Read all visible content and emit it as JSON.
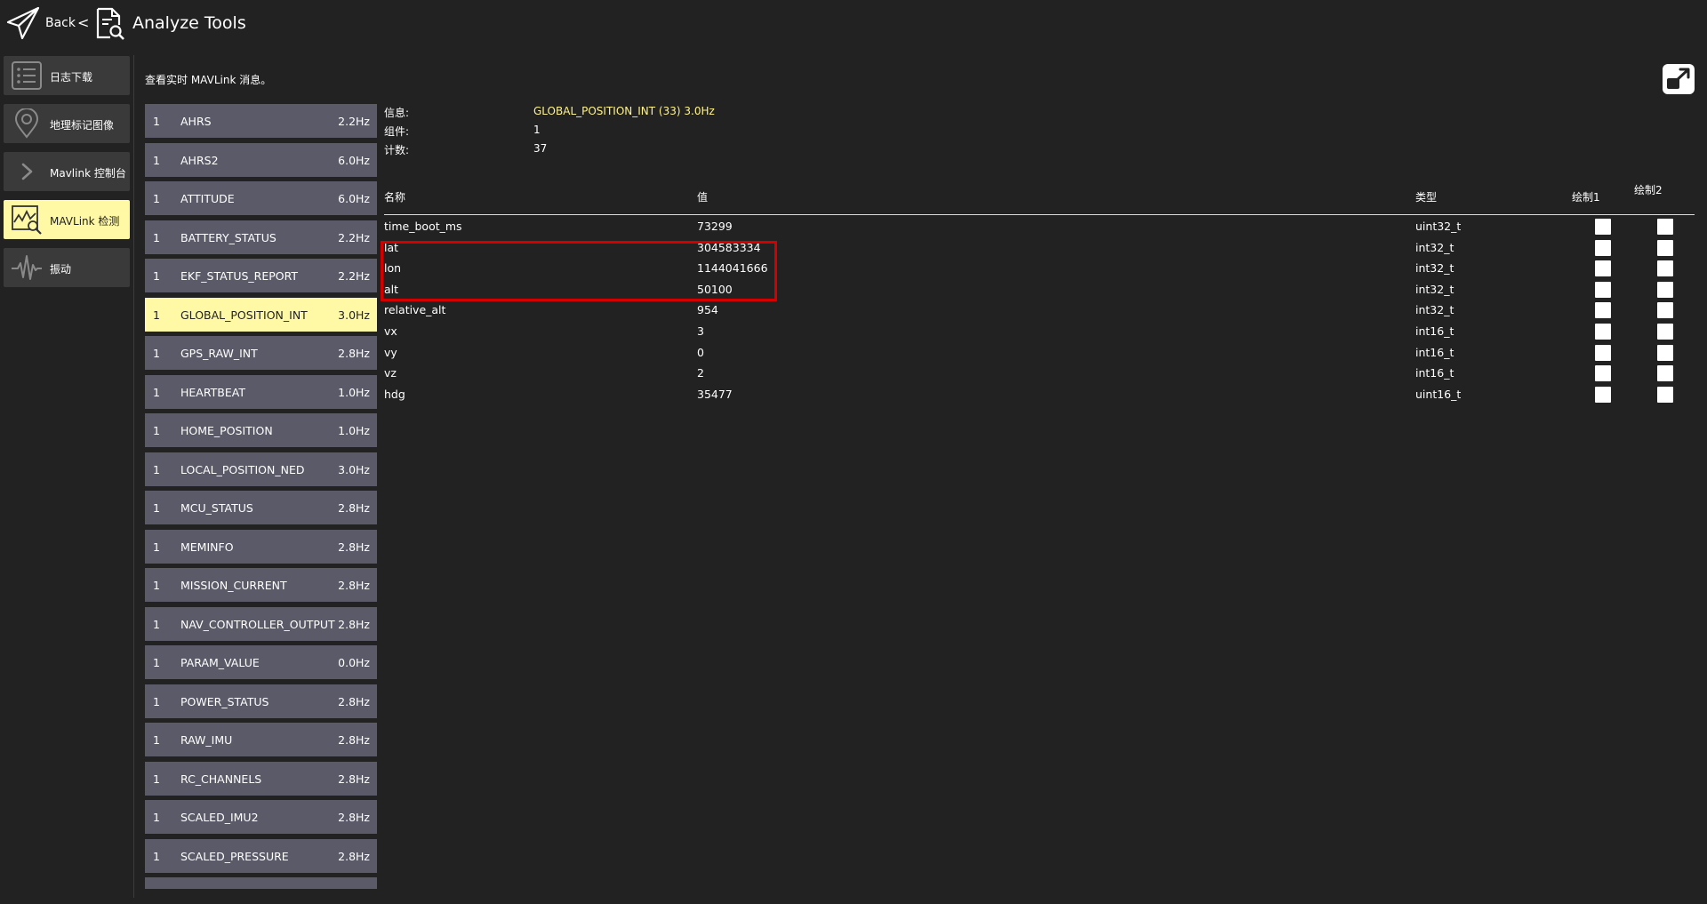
{
  "header": {
    "back_label": "Back",
    "separator": "<",
    "title": "Analyze Tools"
  },
  "nav": [
    {
      "label": "日志下载",
      "icon": "list-icon",
      "active": false
    },
    {
      "label": "地理标记图像",
      "icon": "map-pin-icon",
      "active": false
    },
    {
      "label": "Mavlink 控制台",
      "icon": "chevron-right-icon",
      "active": false
    },
    {
      "label": "MAVLink 检测",
      "icon": "chart-magnifier-icon",
      "active": true
    },
    {
      "label": "振动",
      "icon": "waveform-icon",
      "active": false
    }
  ],
  "description": "查看实时 MAVLink 消息。",
  "messages": [
    {
      "comp": "1",
      "name": "AHRS",
      "rate": "2.2Hz"
    },
    {
      "comp": "1",
      "name": "AHRS2",
      "rate": "6.0Hz"
    },
    {
      "comp": "1",
      "name": "ATTITUDE",
      "rate": "6.0Hz"
    },
    {
      "comp": "1",
      "name": "BATTERY_STATUS",
      "rate": "2.2Hz"
    },
    {
      "comp": "1",
      "name": "EKF_STATUS_REPORT",
      "rate": "2.2Hz"
    },
    {
      "comp": "1",
      "name": "GLOBAL_POSITION_INT",
      "rate": "3.0Hz",
      "selected": true
    },
    {
      "comp": "1",
      "name": "GPS_RAW_INT",
      "rate": "2.8Hz"
    },
    {
      "comp": "1",
      "name": "HEARTBEAT",
      "rate": "1.0Hz"
    },
    {
      "comp": "1",
      "name": "HOME_POSITION",
      "rate": "1.0Hz"
    },
    {
      "comp": "1",
      "name": "LOCAL_POSITION_NED",
      "rate": "3.0Hz"
    },
    {
      "comp": "1",
      "name": "MCU_STATUS",
      "rate": "2.8Hz"
    },
    {
      "comp": "1",
      "name": "MEMINFO",
      "rate": "2.8Hz"
    },
    {
      "comp": "1",
      "name": "MISSION_CURRENT",
      "rate": "2.8Hz"
    },
    {
      "comp": "1",
      "name": "NAV_CONTROLLER_OUTPUT",
      "rate": "2.8Hz"
    },
    {
      "comp": "1",
      "name": "PARAM_VALUE",
      "rate": "0.0Hz"
    },
    {
      "comp": "1",
      "name": "POWER_STATUS",
      "rate": "2.8Hz"
    },
    {
      "comp": "1",
      "name": "RAW_IMU",
      "rate": "2.8Hz"
    },
    {
      "comp": "1",
      "name": "RC_CHANNELS",
      "rate": "2.8Hz"
    },
    {
      "comp": "1",
      "name": "SCALED_IMU2",
      "rate": "2.8Hz"
    },
    {
      "comp": "1",
      "name": "SCALED_PRESSURE",
      "rate": "2.8Hz"
    },
    {
      "comp": "",
      "name": "",
      "rate": ""
    }
  ],
  "detail": {
    "info_label": "信息:",
    "info_value": "GLOBAL_POSITION_INT (33) 3.0Hz",
    "comp_label": "组件:",
    "comp_value": "1",
    "count_label": "计数:",
    "count_value": "37",
    "columns": {
      "name": "名称",
      "value": "值",
      "type": "类型",
      "plot1": "绘制1",
      "plot2": "绘制2"
    },
    "fields": [
      {
        "name": "time_boot_ms",
        "value": "73299",
        "type": "uint32_t"
      },
      {
        "name": "lat",
        "value": "304583334",
        "type": "int32_t"
      },
      {
        "name": "lon",
        "value": "1144041666",
        "type": "int32_t"
      },
      {
        "name": "alt",
        "value": "50100",
        "type": "int32_t"
      },
      {
        "name": "relative_alt",
        "value": "954",
        "type": "int32_t"
      },
      {
        "name": "vx",
        "value": "3",
        "type": "int16_t"
      },
      {
        "name": "vy",
        "value": "0",
        "type": "int16_t"
      },
      {
        "name": "vz",
        "value": "2",
        "type": "int16_t"
      },
      {
        "name": "hdg",
        "value": "35477",
        "type": "uint16_t"
      }
    ]
  },
  "colors": {
    "background": "#222222",
    "nav_button": "#3a3a3a",
    "active_yellow": "#fff9a6",
    "list_item": "#5a5a68",
    "highlight_red": "#d40000",
    "accent_text": "#fff38c"
  },
  "icons": {
    "app": "paper-plane-icon",
    "page": "document-search-icon",
    "popout": "popout-icon"
  }
}
